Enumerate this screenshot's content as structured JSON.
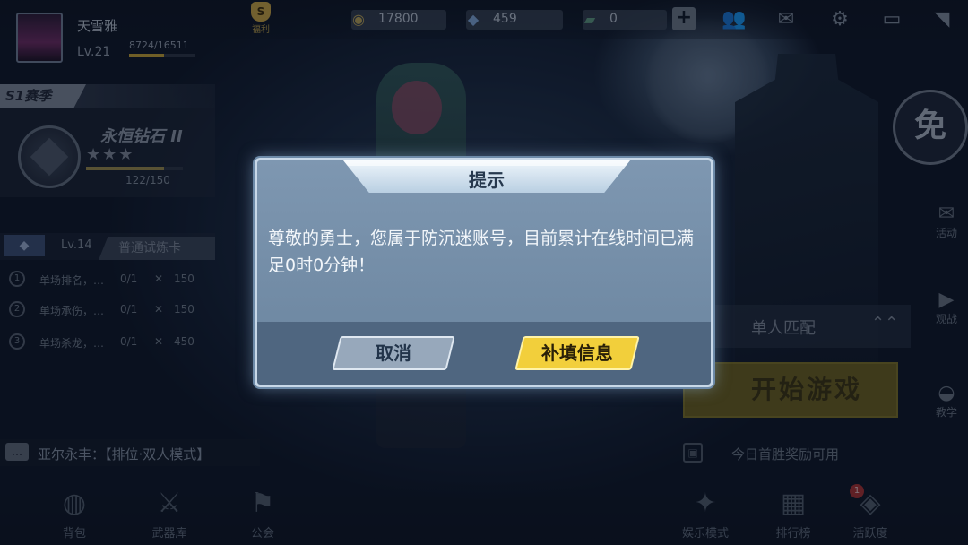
{
  "player": {
    "name": "天雪雅",
    "level": "Lv.21",
    "xp": "8724/16511",
    "xp_fraction": 0.53
  },
  "gold_icon_label": "S",
  "gold_label": "福利",
  "resources": [
    {
      "icon": "coin-icon",
      "glyph": "◉",
      "color": "#b8a256",
      "value": "17800"
    },
    {
      "icon": "diamond-icon",
      "glyph": "◆",
      "color": "#7fa6d6",
      "value": "459"
    },
    {
      "icon": "ticket-icon",
      "glyph": "▰",
      "color": "#5e9a7f",
      "value": "0"
    }
  ],
  "plus_label": "+",
  "season": {
    "tag": "S1赛季",
    "rank": "永恒钻石 II",
    "stars": "★★★",
    "points": "122/150"
  },
  "trial": {
    "icon_label": "◆",
    "level": "Lv.14",
    "card": "普通试炼卡"
  },
  "tasks": [
    {
      "icon": "1",
      "title": "单场排名，…",
      "progress": "0/1",
      "reward_icon": "✕",
      "reward": "150"
    },
    {
      "icon": "2",
      "title": "单场承伤，…",
      "progress": "0/1",
      "reward_icon": "✕",
      "reward": "150"
    },
    {
      "icon": "3",
      "title": "单场杀龙，…",
      "progress": "0/1",
      "reward_icon": "✕",
      "reward": "450"
    }
  ],
  "chat": {
    "icon": "…",
    "text": "亚尔永丰：【排位·双人模式】"
  },
  "nav": [
    {
      "icon": "backpack-icon",
      "glyph": "◍",
      "label": "背包"
    },
    {
      "icon": "weapon-icon",
      "glyph": "⚔",
      "label": "武器库"
    },
    {
      "icon": "guild-icon",
      "glyph": "⚑",
      "label": "公会"
    },
    {
      "icon": "entertainment-icon",
      "glyph": "✦",
      "label": "娱乐模式"
    },
    {
      "icon": "ranking-icon",
      "glyph": "▦",
      "label": "排行榜"
    },
    {
      "icon": "activity-icon",
      "glyph": "◈",
      "label": "活跃度"
    }
  ],
  "activity_badge": "1",
  "free_label": "免",
  "side_menu": [
    {
      "icon": "gift-icon",
      "glyph": "✉",
      "label": "活动"
    },
    {
      "icon": "play-icon",
      "glyph": "▶",
      "label": "观战"
    },
    {
      "icon": "car-icon",
      "glyph": "◒",
      "label": "教学"
    }
  ],
  "match": {
    "mode": "单人匹配",
    "chevron": "⌃⌃",
    "start": "开始游戏",
    "first_win": "今日首胜奖励可用",
    "first_win_icon": "▣"
  },
  "dialog": {
    "title": "提示",
    "message": "尊敬的勇士，您属于防沉迷账号，目前累计在线时间已满足0时0分钟！",
    "cancel": "取消",
    "confirm": "补填信息"
  }
}
